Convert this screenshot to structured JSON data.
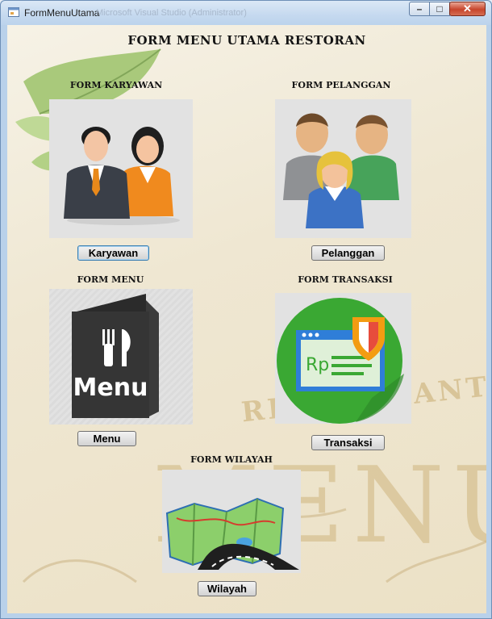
{
  "window": {
    "title": "FormMenuUtama",
    "ghost_title": "Microsoft Visual Studio (Administrator)",
    "controls": {
      "minimize": "–",
      "maximize": "□",
      "close": "✕"
    }
  },
  "form": {
    "title": "FORM MENU UTAMA RESTORAN",
    "sections": {
      "karyawan": {
        "heading": "FORM KARYAWAN",
        "button": "Karyawan"
      },
      "pelanggan": {
        "heading": "FORM PELANGGAN",
        "button": "Pelanggan"
      },
      "menu": {
        "heading": "FORM MENU",
        "button": "Menu",
        "icon_text": "Menu"
      },
      "transaksi": {
        "heading": "FORM TRANSAKSI",
        "button": "Transaksi",
        "icon_text": "Rp"
      },
      "wilayah": {
        "heading": "FORM WILAYAH",
        "button": "Wilayah"
      }
    }
  },
  "background": {
    "text_arc": "RESTAURANT",
    "text_big": "MENU"
  },
  "colors": {
    "titlebar": "#c5d9ef",
    "close": "#c7452c",
    "panel": "#e2e2e2",
    "transaksi_circle": "#3aa833"
  }
}
